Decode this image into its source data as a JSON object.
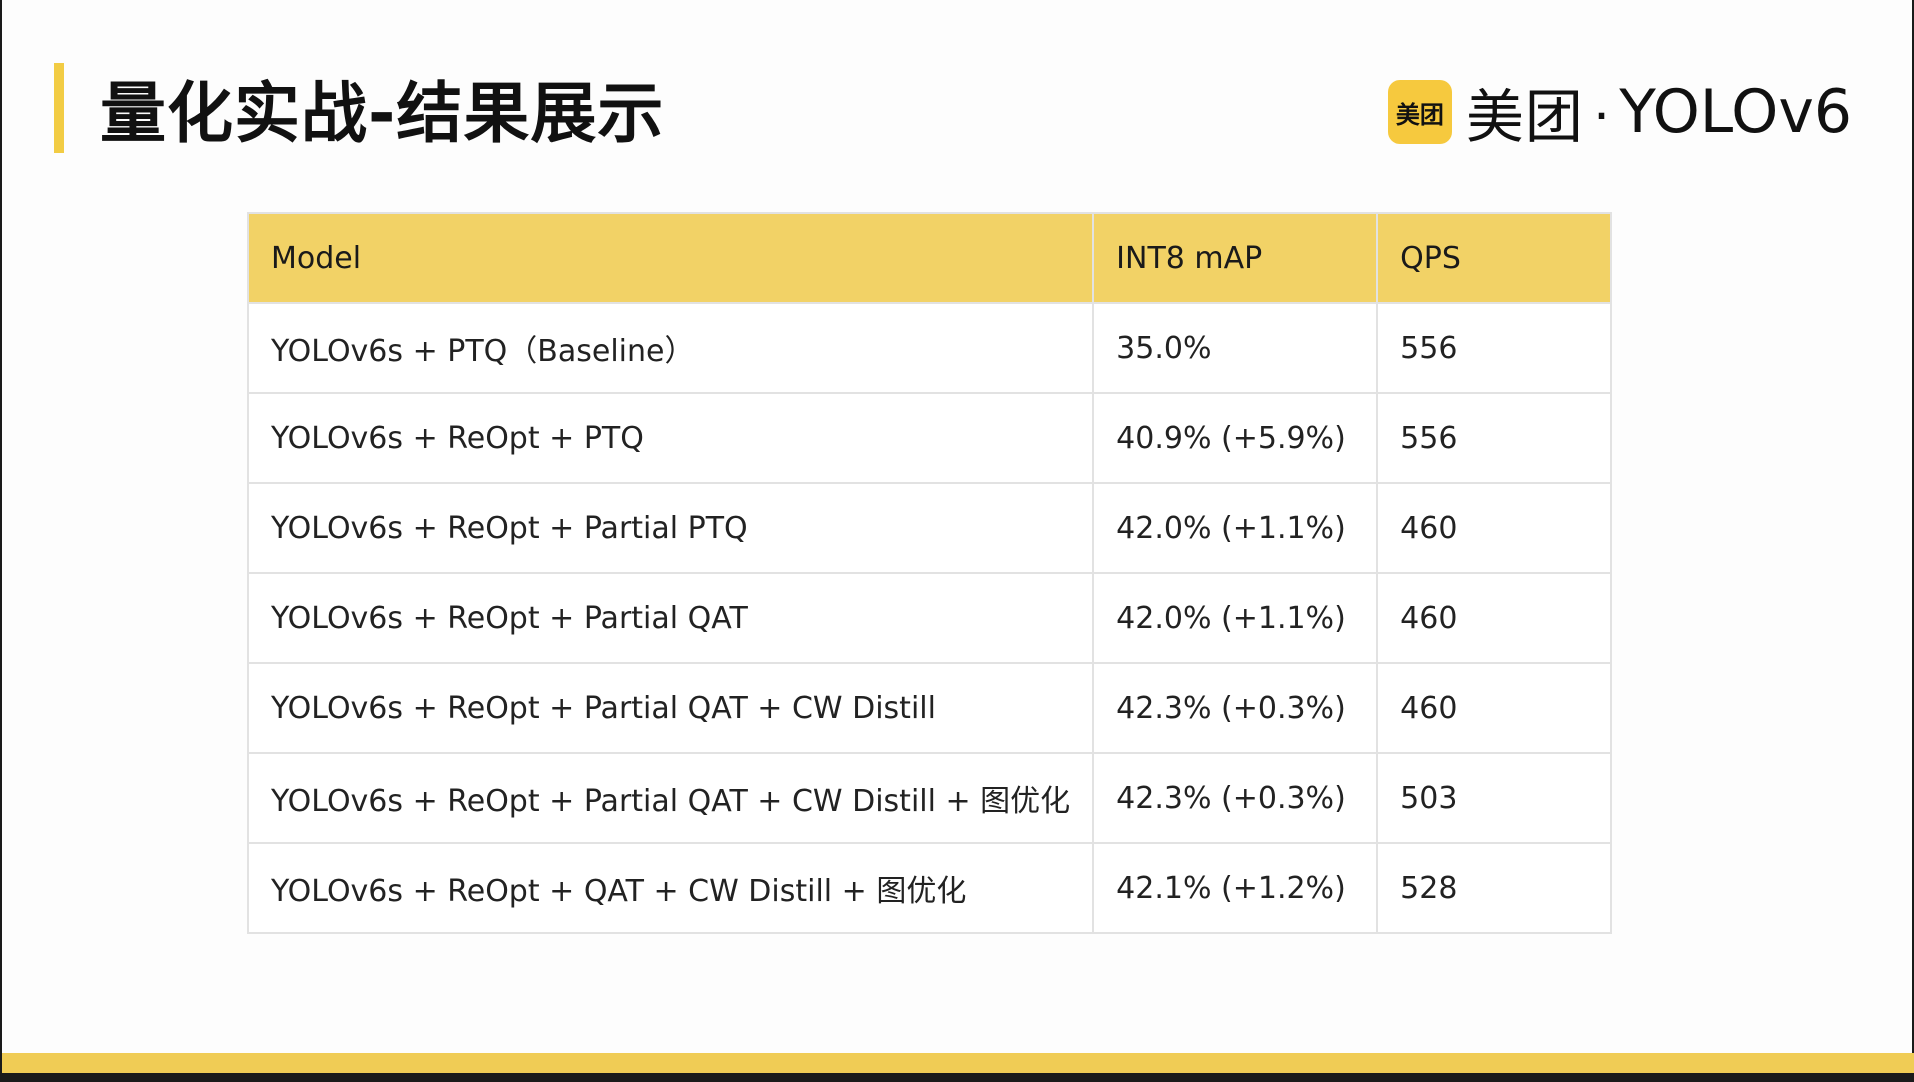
{
  "slide": {
    "title": "量化实战-结果展示",
    "brand": {
      "logo_text": "美团",
      "name": "美团",
      "separator": "·",
      "product": "YOLOv6"
    }
  },
  "table": {
    "headers": [
      "Model",
      "INT8 mAP",
      "QPS"
    ],
    "rows": [
      [
        "YOLOv6s + PTQ（Baseline）",
        "35.0%",
        "556"
      ],
      [
        "YOLOv6s + ReOpt + PTQ",
        "40.9% (+5.9%)",
        "556"
      ],
      [
        "YOLOv6s + ReOpt + Partial PTQ",
        "42.0% (+1.1%)",
        "460"
      ],
      [
        "YOLOv6s + ReOpt + Partial QAT",
        "42.0% (+1.1%)",
        "460"
      ],
      [
        "YOLOv6s + ReOpt + Partial QAT + CW Distill",
        "42.3% (+0.3%)",
        "460"
      ],
      [
        "YOLOv6s + ReOpt + Partial QAT + CW Distill + 图优化",
        "42.3% (+0.3%)",
        "503"
      ],
      [
        "YOLOv6s + ReOpt + QAT + CW Distill + 图优化",
        "42.1% (+1.2%)",
        "528"
      ]
    ]
  },
  "colors": {
    "accent": "#f2cc44",
    "header_fill": "#f2d266",
    "logo_fill": "#f6c93e"
  }
}
